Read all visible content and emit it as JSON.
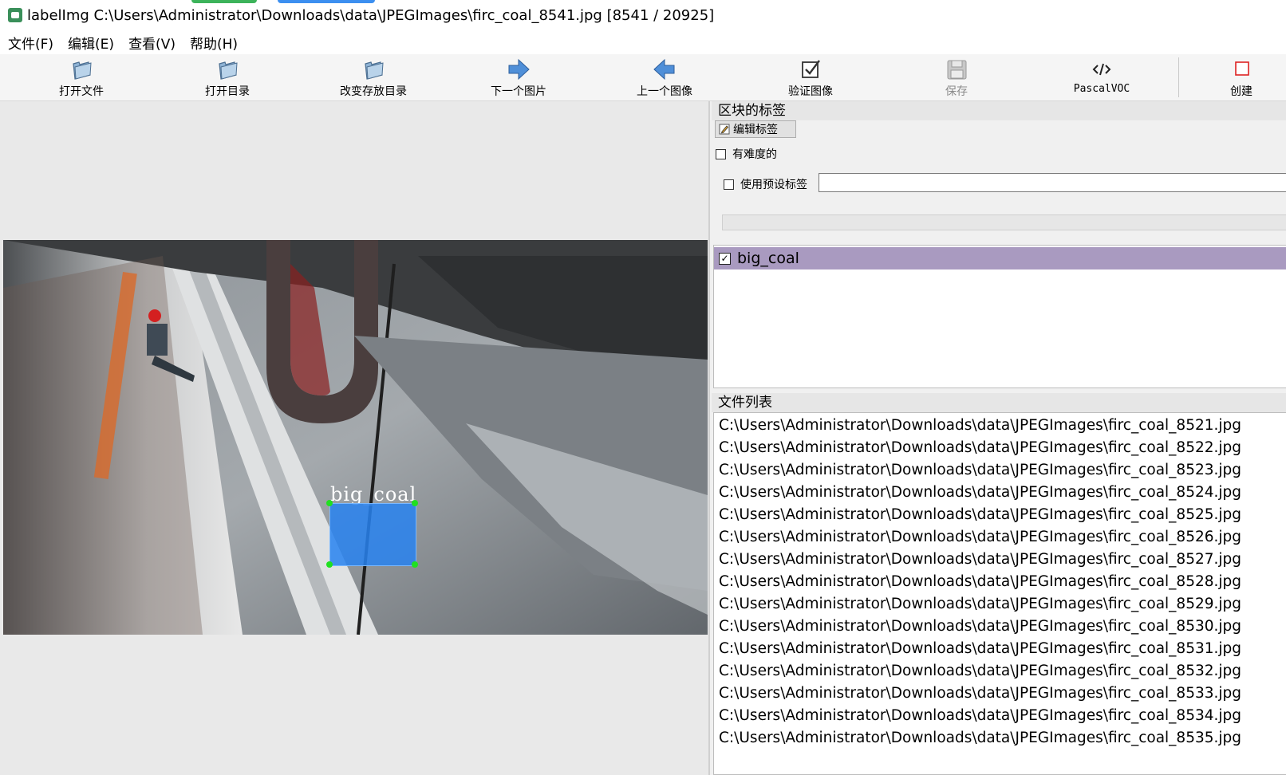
{
  "window": {
    "title": "labelImg C:\\Users\\Administrator\\Downloads\\data\\JPEGImages\\firc_coal_8541.jpg [8541 / 20925]"
  },
  "menu": {
    "items": [
      "文件(F)",
      "编辑(E)",
      "查看(V)",
      "帮助(H)"
    ]
  },
  "toolbar": {
    "open_file": "打开文件",
    "open_dir": "打开目录",
    "change_save_dir": "改变存放目录",
    "next_image": "下一个图片",
    "prev_image": "上一个图像",
    "verify_image": "验证图像",
    "save": "保存",
    "format": "PascalVOC",
    "create": "创建"
  },
  "canvas": {
    "box_label": "big_coal"
  },
  "labels_dock": {
    "title": "区块的标签",
    "edit_button": "编辑标签",
    "difficult_label": "有难度的",
    "use_default_label": "使用预设标签",
    "default_label_value": "",
    "items": [
      {
        "label": "big_coal",
        "checked": true
      }
    ]
  },
  "file_dock": {
    "title": "文件列表",
    "files": [
      "C:\\Users\\Administrator\\Downloads\\data\\JPEGImages\\firc_coal_8521.jpg",
      "C:\\Users\\Administrator\\Downloads\\data\\JPEGImages\\firc_coal_8522.jpg",
      "C:\\Users\\Administrator\\Downloads\\data\\JPEGImages\\firc_coal_8523.jpg",
      "C:\\Users\\Administrator\\Downloads\\data\\JPEGImages\\firc_coal_8524.jpg",
      "C:\\Users\\Administrator\\Downloads\\data\\JPEGImages\\firc_coal_8525.jpg",
      "C:\\Users\\Administrator\\Downloads\\data\\JPEGImages\\firc_coal_8526.jpg",
      "C:\\Users\\Administrator\\Downloads\\data\\JPEGImages\\firc_coal_8527.jpg",
      "C:\\Users\\Administrator\\Downloads\\data\\JPEGImages\\firc_coal_8528.jpg",
      "C:\\Users\\Administrator\\Downloads\\data\\JPEGImages\\firc_coal_8529.jpg",
      "C:\\Users\\Administrator\\Downloads\\data\\JPEGImages\\firc_coal_8530.jpg",
      "C:\\Users\\Administrator\\Downloads\\data\\JPEGImages\\firc_coal_8531.jpg",
      "C:\\Users\\Administrator\\Downloads\\data\\JPEGImages\\firc_coal_8532.jpg",
      "C:\\Users\\Administrator\\Downloads\\data\\JPEGImages\\firc_coal_8533.jpg",
      "C:\\Users\\Administrator\\Downloads\\data\\JPEGImages\\firc_coal_8534.jpg",
      "C:\\Users\\Administrator\\Downloads\\data\\JPEGImages\\firc_coal_8535.jpg"
    ]
  },
  "colors": {
    "selected_label_bg": "#a99ac0",
    "bbox_fill": "#2882f0",
    "bbox_handle": "#20e020"
  }
}
